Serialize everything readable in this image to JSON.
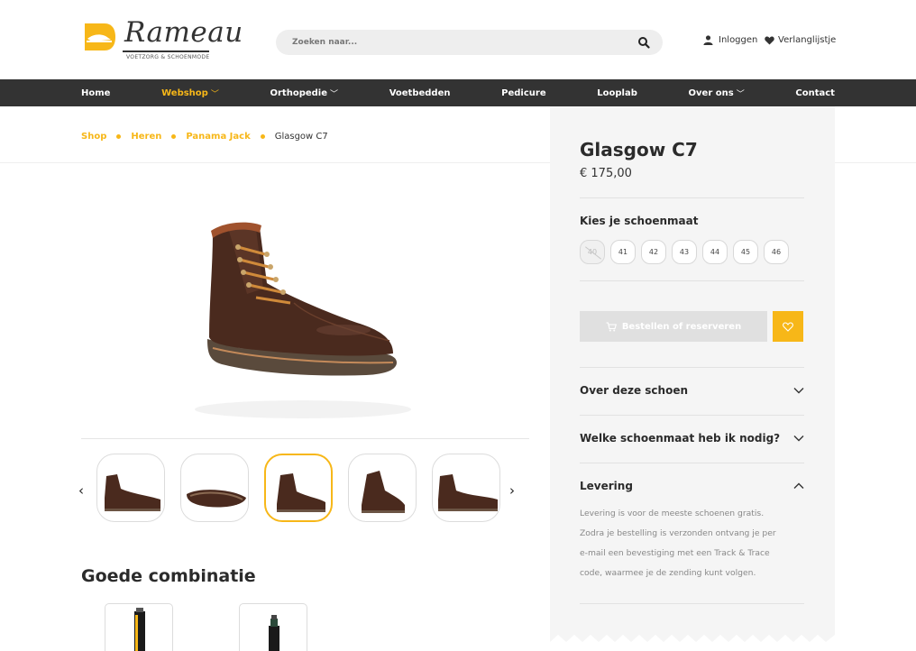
{
  "brand": {
    "name": "Rameau",
    "tagline": "VOETZORG & SCHOENMODE"
  },
  "search": {
    "placeholder": "Zoeken naar..."
  },
  "account": {
    "login_label": "Inloggen",
    "wishlist_label": "Verlanglijstje"
  },
  "nav": {
    "items": [
      {
        "label": "Home"
      },
      {
        "label": "Webshop",
        "dropdown": true
      },
      {
        "label": "Orthopedie",
        "dropdown": true
      },
      {
        "label": "Voetbedden"
      },
      {
        "label": "Pedicure"
      },
      {
        "label": "Looplab"
      },
      {
        "label": "Over ons",
        "dropdown": true
      },
      {
        "label": "Contact"
      }
    ]
  },
  "breadcrumb": {
    "items": [
      "Shop",
      "Heren",
      "Panama Jack"
    ],
    "current": "Glasgow C7"
  },
  "product": {
    "title": "Glasgow C7",
    "price": "€ 175,00",
    "size_label": "Kies je schoenmaat",
    "sizes": [
      "40",
      "41",
      "42",
      "43",
      "44",
      "45",
      "46"
    ],
    "disabled_sizes": [
      "40"
    ],
    "order_button": "Bestellen of reserveren"
  },
  "accordion": {
    "over": {
      "title": "Over deze schoen"
    },
    "maat": {
      "title": "Welke schoenmaat heb ik nodig?"
    },
    "levering": {
      "title": "Levering",
      "lines": [
        "Levering is voor de meeste schoenen gratis.",
        "Zodra je bestelling is verzonden ontvang je per",
        "e-mail een bevestiging met een Track & Trace",
        "code, waarmee je de zending kunt volgen."
      ]
    }
  },
  "combo": {
    "title": "Goede combinatie"
  },
  "colors": {
    "accent": "#f7b718",
    "nav_bg": "#333333",
    "panel_bg": "#f5f5f5",
    "boot": "#4a2a1e"
  }
}
